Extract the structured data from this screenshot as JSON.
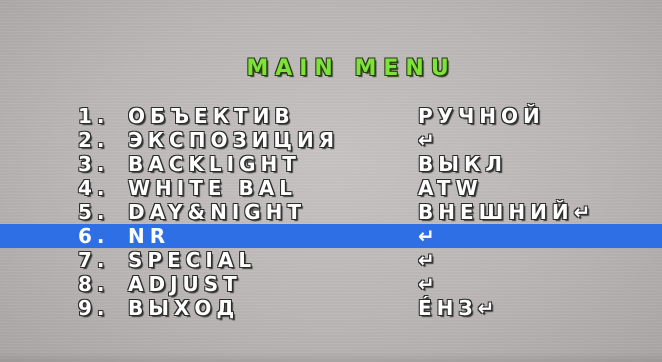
{
  "menu": {
    "title": "MAIN MENU",
    "items": [
      {
        "number": "1.",
        "label": "ОБЪЕКТИВ",
        "value": "РУЧНОЙ"
      },
      {
        "number": "2.",
        "label": "ЭКСПОЗИЦИЯ",
        "value": "↵"
      },
      {
        "number": "3.",
        "label": "BACKLIGHT",
        "value": "ВЫКЛ"
      },
      {
        "number": "4.",
        "label": "WHITE BAL",
        "value": "ATW"
      },
      {
        "number": "5.",
        "label": "DAY&NIGHT",
        "value": "ВНЕШНИЙ↵"
      },
      {
        "number": "6.",
        "label": "NR",
        "value": "↵",
        "selected": true
      },
      {
        "number": "7.",
        "label": "SPECIAL",
        "value": "↵"
      },
      {
        "number": "8.",
        "label": "ADJUST",
        "value": "↵"
      },
      {
        "number": "9.",
        "label": "ВЫХОД",
        "value": "ÉНЗ↵"
      }
    ]
  },
  "colors": {
    "title": "#7de23a",
    "text": "#ffffff",
    "highlight": "#2f6fe6",
    "background": "#bab6b5"
  }
}
